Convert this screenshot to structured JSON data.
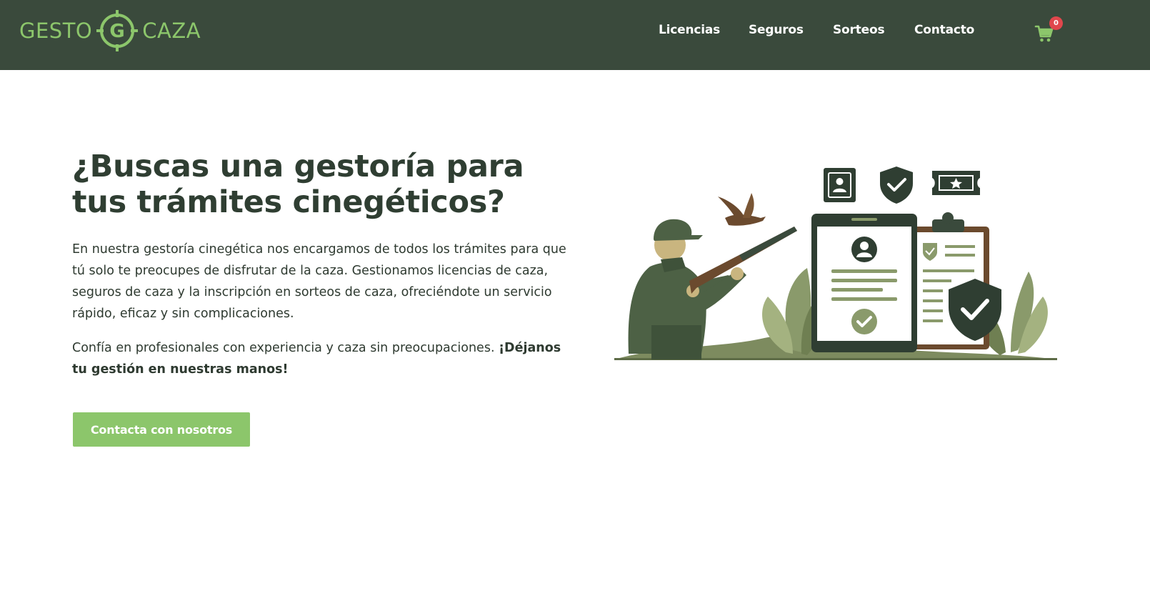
{
  "brand": {
    "left": "GESTO",
    "right": "CAZA",
    "monogram": "G",
    "color": "#8cc66b"
  },
  "nav": {
    "items": [
      {
        "label": "Licencias"
      },
      {
        "label": "Seguros"
      },
      {
        "label": "Sorteos"
      },
      {
        "label": "Contacto"
      }
    ]
  },
  "cart": {
    "icon": "cart-icon",
    "count": "0",
    "badge_color": "#e0474c"
  },
  "hero": {
    "title": "¿Buscas una gestoría para tus trámites cinegéticos?",
    "paragraph1": "En nuestra gestoría cinegética nos encargamos de todos los trámites para que tú solo te preocupes de disfrutar de la caza. Gestionamos licencias de caza, seguros de caza y la inscripción en sorteos de caza, ofreciéndote un servicio rápido, eficaz y sin complicaciones.",
    "paragraph2_lead": "Confía en profesionales con experiencia y caza sin preocupaciones. ",
    "paragraph2_bold": "¡Déjanos tu gestión en nuestras manos!",
    "cta_label": "Contacta con nosotros"
  },
  "colors": {
    "header_bg": "#3a4a3c",
    "accent": "#8cc66b",
    "heading": "#2f3e32"
  }
}
